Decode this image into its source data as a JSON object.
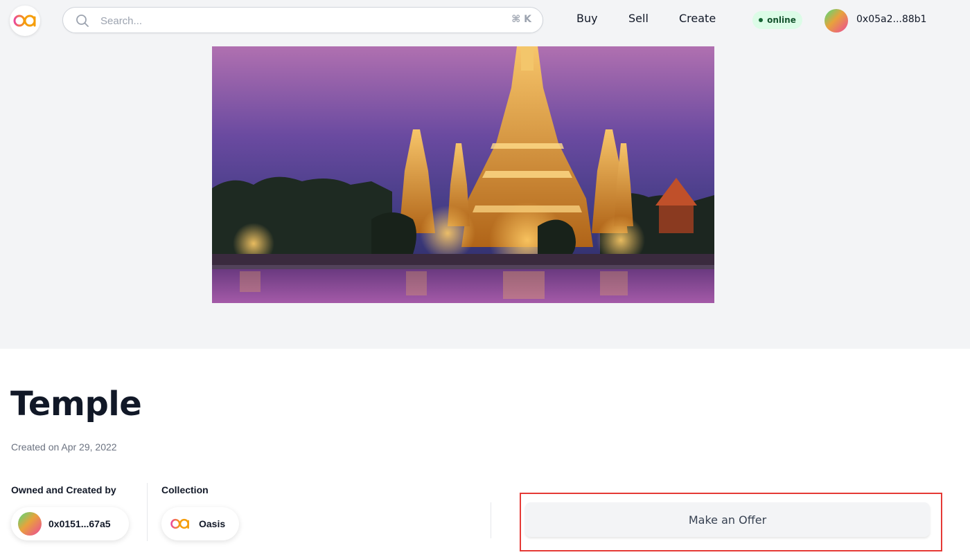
{
  "header": {
    "search": {
      "placeholder": "Search...",
      "shortcut": "⌘ K"
    },
    "nav": {
      "buy": "Buy",
      "sell": "Sell",
      "create": "Create"
    },
    "status": "online",
    "account": {
      "address": "0x05a2...88b1"
    }
  },
  "artwork": {
    "subject": "temple-at-dusk"
  },
  "details": {
    "title": "Temple",
    "created": "Created on Apr 29, 2022",
    "owner_label": "Owned and Created by",
    "owner_address": "0x0151...67a5",
    "collection_label": "Collection",
    "collection_name": "Oasis"
  },
  "actions": {
    "offer_label": "Make an Offer"
  },
  "colors": {
    "brand_pink": "#ec6a9c",
    "brand_orange": "#f59e0b",
    "online_bg": "#dcfce7",
    "online_text": "#14532d",
    "highlight": "#e53935"
  }
}
